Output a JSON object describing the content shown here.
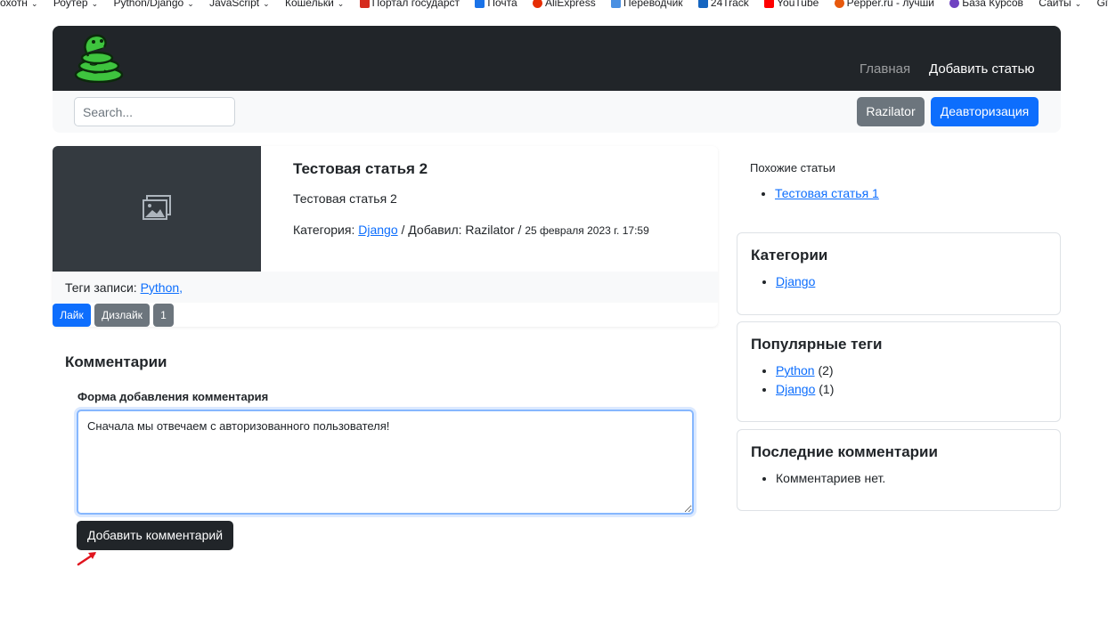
{
  "bookmarks": [
    {
      "label": "охотн",
      "chevron": true
    },
    {
      "label": "Роутер",
      "chevron": true
    },
    {
      "label": "Python/Django",
      "chevron": true
    },
    {
      "label": "JavaScript",
      "chevron": true
    },
    {
      "label": "Кошельки",
      "chevron": true
    },
    {
      "label": "Портал государст",
      "icon": "flag-icon",
      "color": "#d52b1e"
    },
    {
      "label": "Почта",
      "icon": "mail-icon",
      "color": "#1a73e8"
    },
    {
      "label": "AliExpress",
      "icon": "aliexpress-icon",
      "color": "#e62e04"
    },
    {
      "label": "Переводчик",
      "icon": "translate-icon",
      "color": "#4a90e2"
    },
    {
      "label": "24Track",
      "icon": "track-icon",
      "color": "#1565c0"
    },
    {
      "label": "YouTube",
      "icon": "youtube-icon",
      "color": "#ff0000"
    },
    {
      "label": "Pepper.ru - лучши",
      "icon": "pepper-icon",
      "color": "#e8590c"
    },
    {
      "label": "База Курсов",
      "icon": "courses-icon",
      "color": "#6f42c1"
    },
    {
      "label": "Сайты",
      "chevron": true
    },
    {
      "label": "GitHub",
      "chevron": true
    }
  ],
  "navbar": {
    "home": "Главная",
    "add_article": "Добавить статью"
  },
  "search": {
    "placeholder": "Search..."
  },
  "user": {
    "username": "Razilator",
    "logout": "Деавторизация"
  },
  "article": {
    "title": "Тестовая статья 2",
    "description": "Тестовая статья 2",
    "category_label": "Категория:",
    "category": "Django",
    "added_by_label": "/ Добавил:",
    "author": "Razilator",
    "separator": "/",
    "date": "25 февраля 2023 г. 17:59",
    "tags_label": "Теги записи:",
    "tag": "Python",
    "tag_suffix": ",",
    "like": "Лайк",
    "dislike": "Дизлайк",
    "rating": "1"
  },
  "comments": {
    "heading": "Комментарии",
    "form_label": "Форма добавления комментария",
    "textarea_value": "Сначала мы отвечаем с авторизованного пользователя!",
    "submit": "Добавить комментарий"
  },
  "sidebar": {
    "similar_title": "Похожие статьи",
    "similar_items": [
      "Тестовая статья 1"
    ],
    "categories_title": "Категории",
    "categories": [
      "Django"
    ],
    "popular_tags_title": "Популярные теги",
    "popular_tags": [
      {
        "name": "Python",
        "count": "(2)"
      },
      {
        "name": "Django",
        "count": "(1)"
      }
    ],
    "latest_comments_title": "Последние комментарии",
    "latest_comments_empty": "Комментариев нет."
  },
  "colors": {
    "primary": "#0d6efd",
    "secondary": "#6c757d",
    "dark": "#212529"
  }
}
